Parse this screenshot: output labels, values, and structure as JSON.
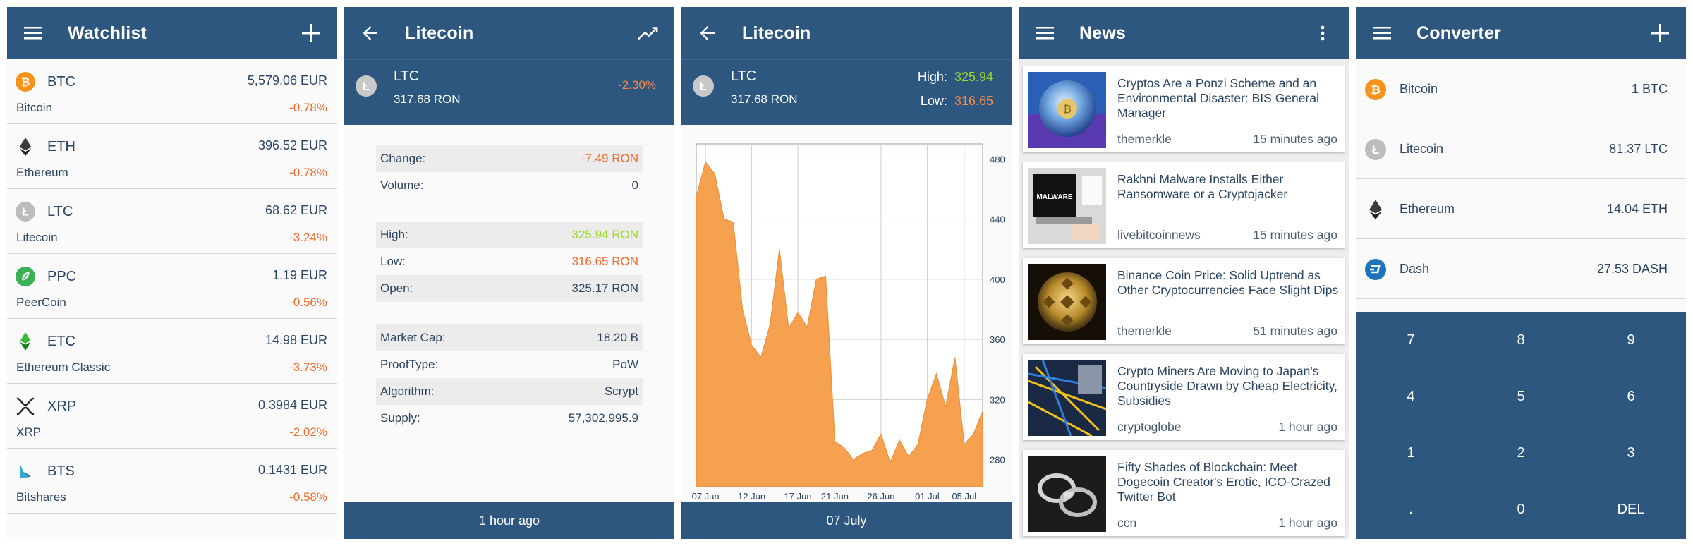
{
  "colors": {
    "appbar": "#2e5780",
    "negative": "#f26a2b",
    "positive": "#9ad82a",
    "chart_fill": "#f5a14f"
  },
  "watchlist": {
    "title": "Watchlist",
    "nav_icon": "menu-icon",
    "action_icon": "plus-icon",
    "items": [
      {
        "symbol": "BTC",
        "price": "5,579.06 EUR",
        "name": "Bitcoin",
        "change": "-0.78%",
        "icon": "bitcoin-icon"
      },
      {
        "symbol": "ETH",
        "price": "396.52 EUR",
        "name": "Ethereum",
        "change": "-0.78%",
        "icon": "ethereum-icon"
      },
      {
        "symbol": "LTC",
        "price": "68.62 EUR",
        "name": "Litecoin",
        "change": "-3.24%",
        "icon": "litecoin-icon"
      },
      {
        "symbol": "PPC",
        "price": "1.19 EUR",
        "name": "PeerCoin",
        "change": "-0.56%",
        "icon": "peercoin-icon"
      },
      {
        "symbol": "ETC",
        "price": "14.98 EUR",
        "name": "Ethereum Classic",
        "change": "-3.73%",
        "icon": "ethereum-classic-icon"
      },
      {
        "symbol": "XRP",
        "price": "0.3984 EUR",
        "name": "XRP",
        "change": "-2.02%",
        "icon": "xrp-icon"
      },
      {
        "symbol": "BTS",
        "price": "0.1431 EUR",
        "name": "Bitshares",
        "change": "-0.58%",
        "icon": "bitshares-icon"
      }
    ]
  },
  "details_screen": {
    "title": "Litecoin",
    "nav_icon": "back-arrow-icon",
    "action_icon": "trending-chart-icon",
    "symbol": "LTC",
    "price": "317.68 RON",
    "change": "-2.30%",
    "group1": [
      {
        "label": "Change:",
        "value": "-7.49 RON",
        "tone": "orange"
      },
      {
        "label": "Volume:",
        "value": "0",
        "tone": ""
      }
    ],
    "group2": [
      {
        "label": "High:",
        "value": "325.94 RON",
        "tone": "green"
      },
      {
        "label": "Low:",
        "value": "316.65 RON",
        "tone": "orange"
      },
      {
        "label": "Open:",
        "value": "325.17 RON",
        "tone": ""
      }
    ],
    "group3": [
      {
        "label": "Market Cap:",
        "value": "18.20 B",
        "tone": ""
      },
      {
        "label": "ProofType:",
        "value": "PoW",
        "tone": ""
      },
      {
        "label": "Algorithm:",
        "value": "Scrypt",
        "tone": ""
      },
      {
        "label": "Supply:",
        "value": "57,302,995.9",
        "tone": ""
      }
    ],
    "footer": "1 hour ago"
  },
  "chart_screen": {
    "title": "Litecoin",
    "nav_icon": "back-arrow-icon",
    "symbol": "LTC",
    "price": "317.68 RON",
    "high_label": "High:",
    "high_value": "325.94",
    "low_label": "Low:",
    "low_value": "316.65",
    "footer": "07 July"
  },
  "chart_data": {
    "type": "area",
    "x_tick_labels": [
      "07 Jun",
      "12 Jun",
      "17 Jun",
      "21 Jun",
      "26 Jun",
      "01 Jul",
      "05 Jul"
    ],
    "y_ticks": [
      280,
      320,
      360,
      400,
      440,
      480
    ],
    "ylim": [
      262,
      490
    ],
    "y_axis_side": "right",
    "grid": true,
    "x": [
      "06 Jun",
      "07 Jun",
      "08 Jun",
      "09 Jun",
      "10 Jun",
      "11 Jun",
      "12 Jun",
      "13 Jun",
      "14 Jun",
      "15 Jun",
      "16 Jun",
      "17 Jun",
      "18 Jun",
      "19 Jun",
      "20 Jun",
      "21 Jun",
      "22 Jun",
      "23 Jun",
      "24 Jun",
      "25 Jun",
      "26 Jun",
      "27 Jun",
      "28 Jun",
      "29 Jun",
      "30 Jun",
      "01 Jul",
      "02 Jul",
      "03 Jul",
      "04 Jul",
      "05 Jul",
      "06 Jul",
      "07 Jul"
    ],
    "values": [
      455,
      478,
      470,
      440,
      438,
      380,
      356,
      348,
      370,
      420,
      367,
      378,
      368,
      400,
      402,
      292,
      288,
      280,
      284,
      286,
      297,
      278,
      293,
      282,
      290,
      320,
      337,
      315,
      348,
      290,
      297,
      312
    ]
  },
  "news": {
    "title": "News",
    "nav_icon": "menu-icon",
    "action_icon": "more-vert-icon",
    "items": [
      {
        "title": "Cryptos Are a Ponzi Scheme and an Environmental Disaster: BIS General Manager",
        "source": "themerkle",
        "time": "15 minutes ago",
        "thumb": "crystal-ball-thumbnail"
      },
      {
        "title": "Rakhni Malware Installs Either Ransomware or a Cryptojacker",
        "source": "livebitcoinnews",
        "time": "15 minutes ago",
        "thumb": "malware-laptop-thumbnail"
      },
      {
        "title": "Binance Coin Price: Solid Uptrend as Other Cryptocurrencies Face Slight Dips",
        "source": "themerkle",
        "time": "51 minutes ago",
        "thumb": "binance-coin-thumbnail"
      },
      {
        "title": "Crypto Miners Are Moving to Japan's Countryside Drawn by Cheap Electricity, Subsidies",
        "source": "cryptoglobe",
        "time": "1 hour ago",
        "thumb": "server-cables-thumbnail"
      },
      {
        "title": "Fifty Shades of Blockchain: Meet Dogecoin Creator's Erotic, ICO-Crazed Twitter Bot",
        "source": "ccn",
        "time": "1 hour ago",
        "thumb": "handcuffs-thumbnail"
      }
    ]
  },
  "converter": {
    "title": "Converter",
    "nav_icon": "menu-icon",
    "action_icon": "plus-icon",
    "items": [
      {
        "name": "Bitcoin",
        "value": "1 BTC",
        "icon": "bitcoin-icon"
      },
      {
        "name": "Litecoin",
        "value": "81.37 LTC",
        "icon": "litecoin-icon"
      },
      {
        "name": "Ethereum",
        "value": "14.04 ETH",
        "icon": "ethereum-icon"
      },
      {
        "name": "Dash",
        "value": "27.53 DASH",
        "icon": "dash-icon"
      }
    ],
    "keys": [
      "7",
      "8",
      "9",
      "4",
      "5",
      "6",
      "1",
      "2",
      "3",
      ".",
      "0",
      "DEL"
    ]
  }
}
